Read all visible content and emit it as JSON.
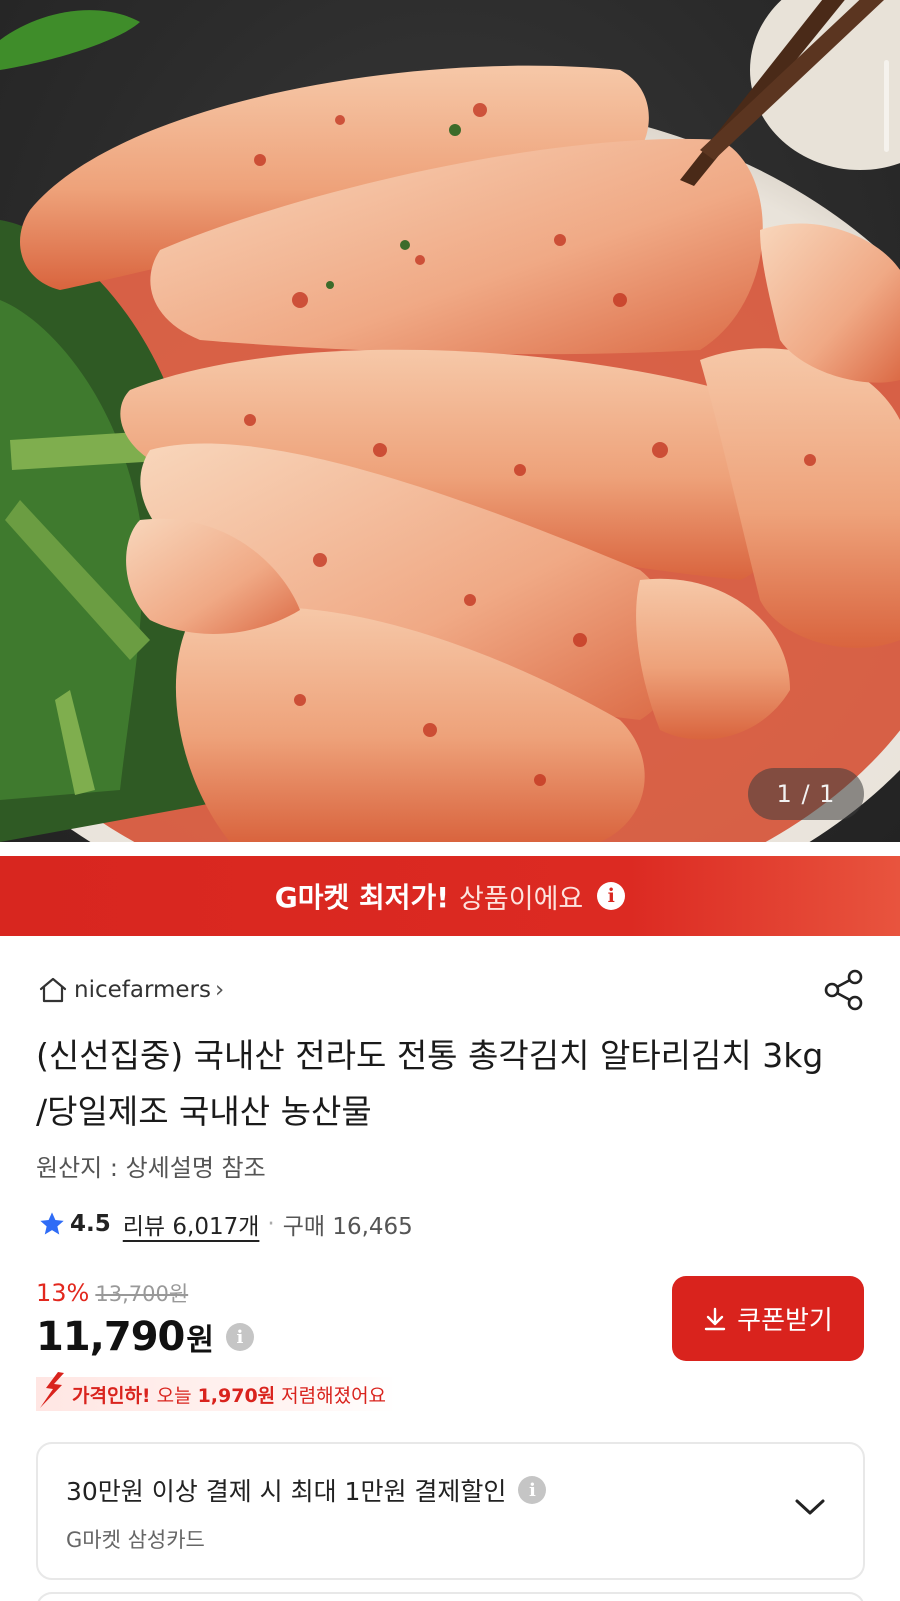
{
  "gallery": {
    "counter": "1 / 1"
  },
  "banner": {
    "bold": "G마켓 최저가!",
    "rest": "상품이에요"
  },
  "seller": {
    "name": "nicefarmers",
    "chevron": "›"
  },
  "product": {
    "title": "(신선집중) 국내산 전라도 전통 총각김치 알타리김치 3kg /당일제조 국내산 농산물",
    "origin": "원산지 : 상세설명 참조"
  },
  "rating": {
    "value": "4.5",
    "reviews": "리뷰 6,017개",
    "separator": "·",
    "purchases": "구매 16,465",
    "rating_fraction": 0.9
  },
  "price": {
    "discount_rate": "13%",
    "original": "13,700원",
    "current": "11,790",
    "currency": "원"
  },
  "coupon": {
    "label": "쿠폰받기"
  },
  "price_drop": {
    "prefix": "가격인하!",
    "middle": "오늘",
    "amount": "1,970원",
    "suffix": "저렴해졌어요"
  },
  "card_promo": {
    "title": "30만원 이상 결제 시 최대 1만원 결제할인",
    "subtitle": "G마켓 삼성카드"
  },
  "colors": {
    "brand_red": "#d9231d",
    "star_blue": "#2f6cf6"
  },
  "icons": [
    "home-icon",
    "share-icon",
    "star-icon",
    "info-icon",
    "download-icon",
    "price-down-arrow-icon",
    "chevron-down-icon"
  ]
}
